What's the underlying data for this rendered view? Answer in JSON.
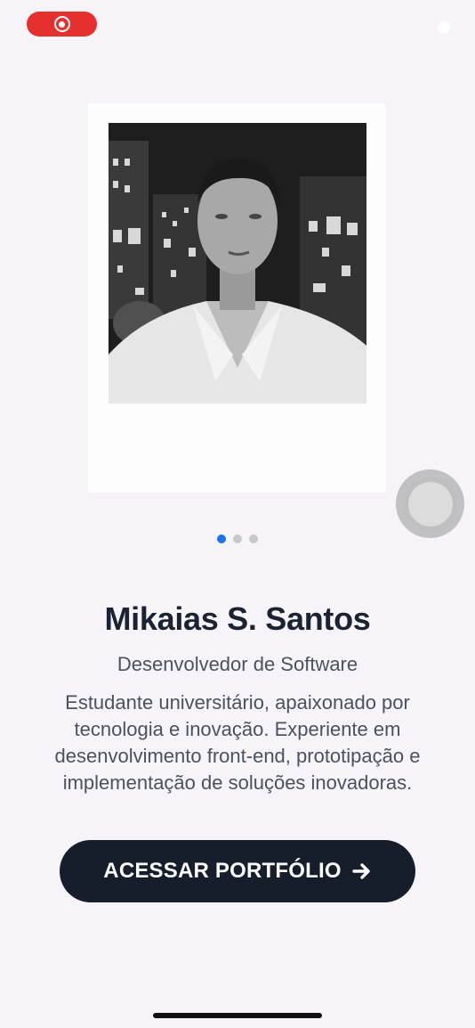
{
  "status_bar": {
    "recording_icon": "screen-record-icon",
    "recording_color": "#e5302e"
  },
  "carousel": {
    "photo_alt": "Profile photo",
    "total_slides": 3,
    "active_slide": 1,
    "active_color": "#1a73e8"
  },
  "profile": {
    "name": "Mikaias S. Santos",
    "role": "Desenvolvedor de Software",
    "bio": "Estudante universitário, apaixonado por tecnologia e inovação. Experiente em desenvolvimento front-end, prototipação e implementação de soluções inovadoras."
  },
  "cta": {
    "label": "ACESSAR PORTFÓLIO",
    "icon": "arrow-right-icon",
    "background": "#171e2b"
  },
  "assistive_touch": {
    "icon": "assistive-touch-icon"
  }
}
